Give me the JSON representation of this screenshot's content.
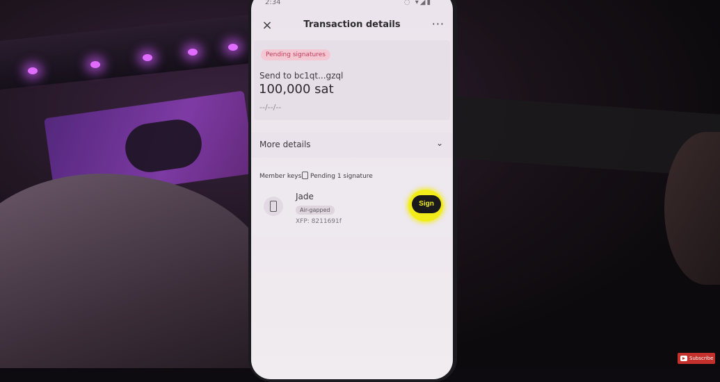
{
  "status_bar": {
    "time": "2:34",
    "icons": "◌ ▾◢▮"
  },
  "header": {
    "title": "Transaction details",
    "close_icon": "×",
    "more_icon": "···"
  },
  "transaction": {
    "status_badge": "Pending signatures",
    "send_to": "Send to bc1qt...gzql",
    "amount": "100,000 sat",
    "date": "--/--/--"
  },
  "more_details": {
    "label": "More details",
    "chevron": "⌄"
  },
  "member_keys": {
    "label": "Member keys",
    "pending": "Pending 1 signature",
    "keys": [
      {
        "name": "Jade",
        "tag": "Air-gapped",
        "xfp": "XFP: 8211691f",
        "action": "Sign"
      }
    ]
  },
  "overlay": {
    "subscribe": "Subscribe"
  },
  "colors": {
    "highlight": "#f2ec1a",
    "badge_bg": "#f4c8d3",
    "badge_text": "#c43a5c",
    "led": "#e06cff"
  }
}
